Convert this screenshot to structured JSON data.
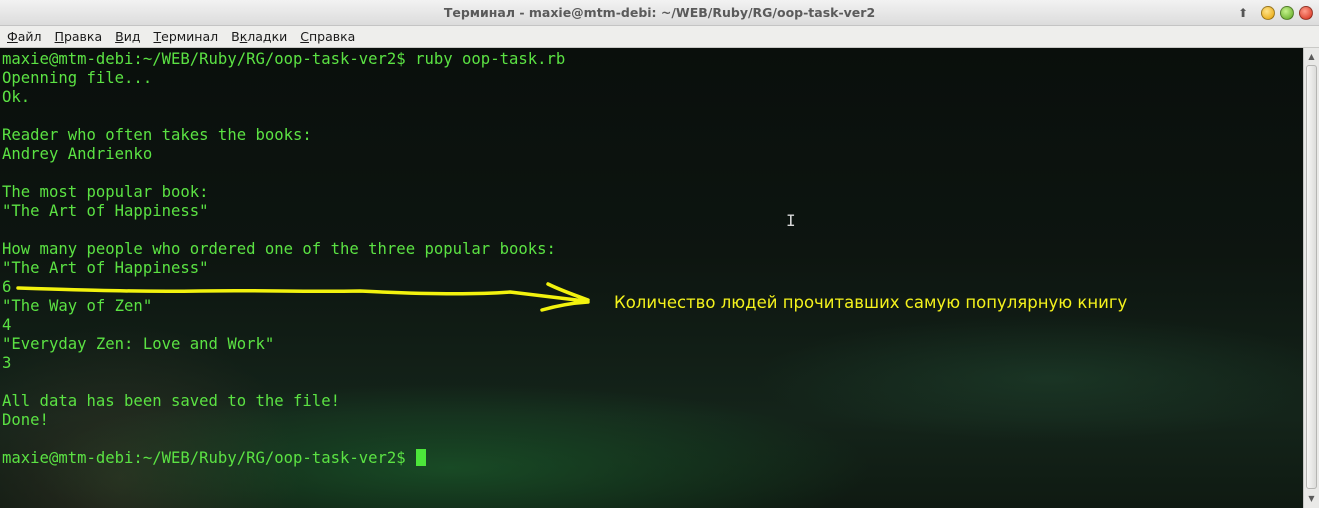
{
  "window": {
    "title": "Терминал - maxie@mtm-debi: ~/WEB/Ruby/RG/oop-task-ver2",
    "up_arrow": "⬆"
  },
  "menu": [
    {
      "label": "Файл",
      "accel": "Ф",
      "rest": "айл"
    },
    {
      "label": "Правка",
      "accel": "П",
      "rest": "равка"
    },
    {
      "label": "Вид",
      "accel": "В",
      "rest": "ид"
    },
    {
      "label": "Терминал",
      "accel": "Т",
      "rest": "ерминал"
    },
    {
      "label": "Вкладки",
      "accel": "В",
      "rest": "кладки",
      "accel_index": 1
    },
    {
      "label": "Справка",
      "accel": "С",
      "rest": "правка"
    }
  ],
  "terminal": {
    "lines": [
      "maxie@mtm-debi:~/WEB/Ruby/RG/oop-task-ver2$ ruby oop-task.rb",
      "Openning file...",
      "Ok.",
      "",
      "Reader who often takes the books:",
      "Andrey Andrienko",
      "",
      "The most popular book:",
      "\"The Art of Happiness\"",
      "",
      "How many people who ordered one of the three popular books:",
      "\"The Art of Happiness\"",
      "6",
      "\"The Way of Zen\"",
      "4",
      "\"Everyday Zen: Love and Work\"",
      "3",
      "",
      "All data has been saved to the file!",
      "Done!",
      ""
    ],
    "prompt": "maxie@mtm-debi:~/WEB/Ruby/RG/oop-task-ver2$ ",
    "text_color": "#5be243",
    "cursor_color": "#4ce53a"
  },
  "annotation": {
    "text": "Количество людей прочитавших самую популярную книгу",
    "color": "#f4f21c"
  }
}
